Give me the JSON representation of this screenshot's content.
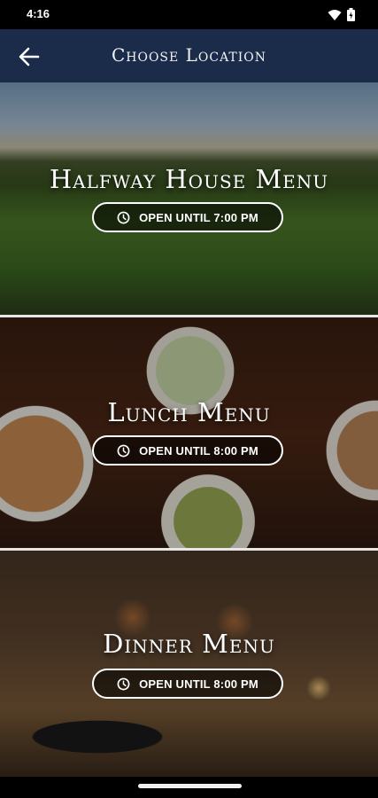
{
  "status_bar": {
    "time": "4:16"
  },
  "app_bar": {
    "title": "Choose Location"
  },
  "menus": [
    {
      "title": "Halfway House Menu",
      "hours": "OPEN UNTIL 7:00 PM"
    },
    {
      "title": "Lunch Menu",
      "hours": "OPEN UNTIL 8:00 PM"
    },
    {
      "title": "Dinner Menu",
      "hours": "OPEN UNTIL 8:00 PM"
    }
  ],
  "icons": {
    "back": "arrow-left-icon",
    "clock": "clock-icon",
    "wifi": "wifi-icon",
    "battery": "battery-icon"
  }
}
